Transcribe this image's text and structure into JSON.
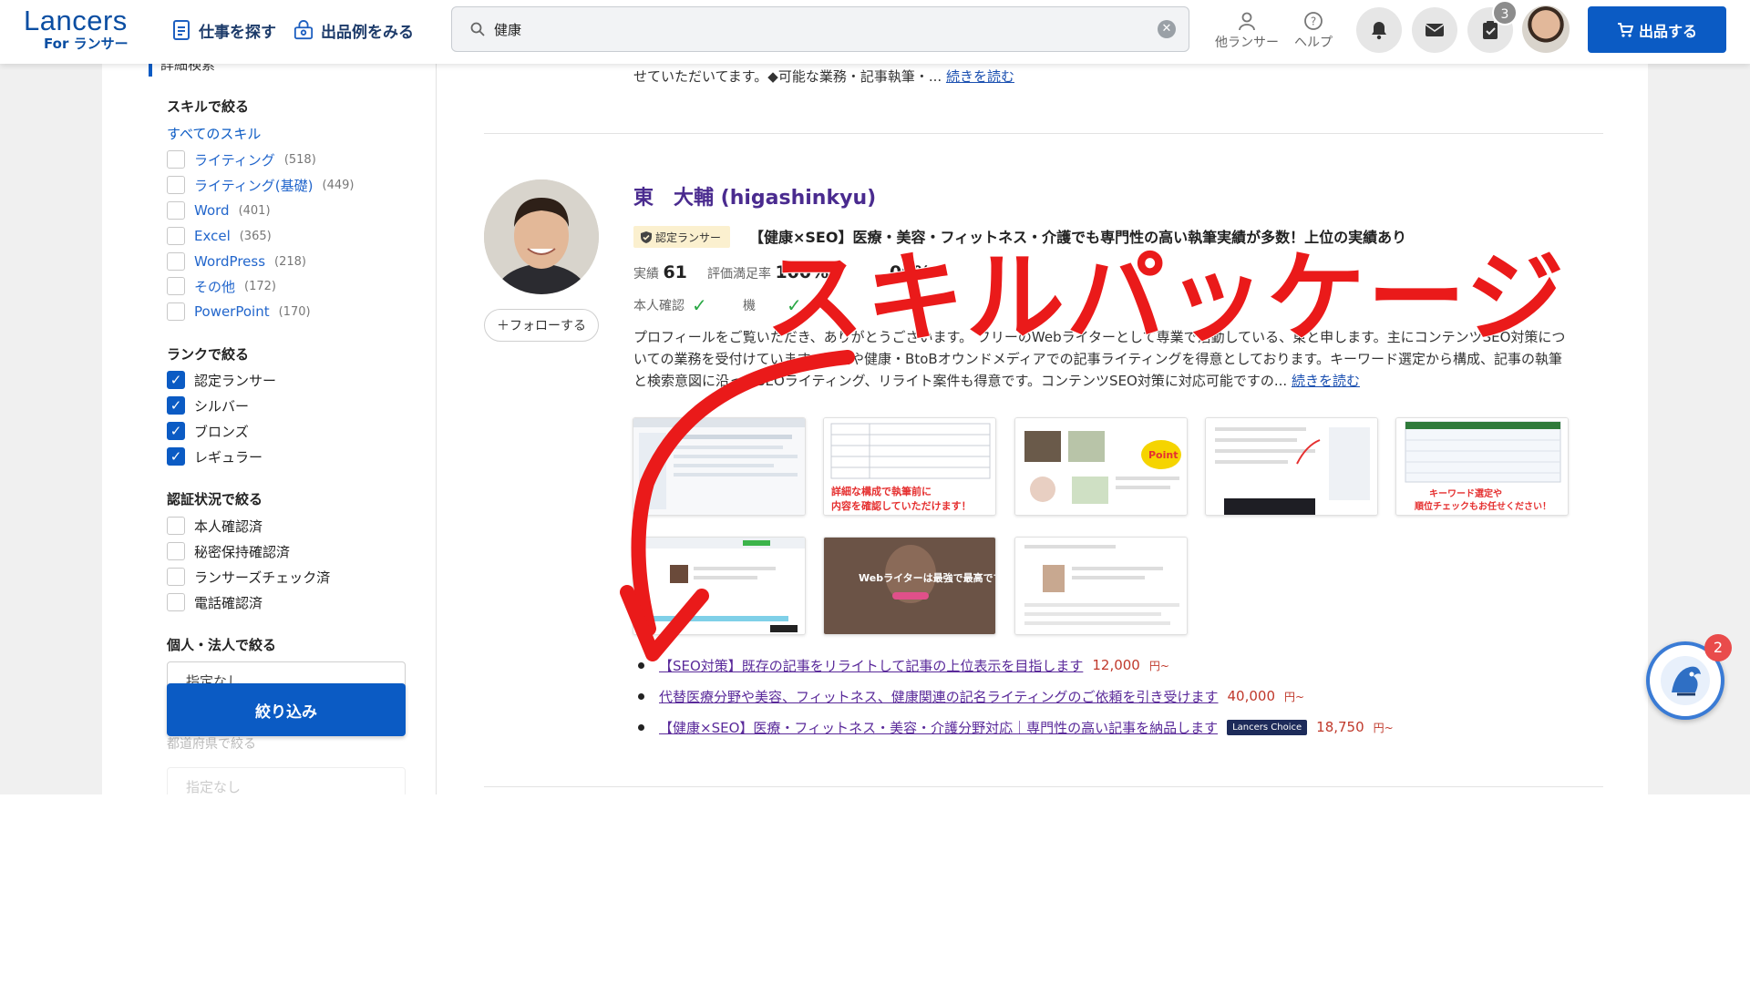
{
  "header": {
    "logo_main": "Lancers",
    "logo_sub": "For ランサー",
    "nav_find_work": "仕事を探す",
    "nav_examples": "出品例をみる",
    "search_value": "健康",
    "other_lancers": "他ランサー",
    "help": "ヘルプ",
    "task_badge_count": "3",
    "publish_label": "出品する"
  },
  "sidebar": {
    "heading": "詳細検索",
    "skill_section": "スキルで絞る",
    "all_skills": "すべてのスキル",
    "skills": [
      {
        "label": "ライティング",
        "count": "(518)"
      },
      {
        "label": "ライティング(基礎)",
        "count": "(449)"
      },
      {
        "label": "Word",
        "count": "(401)"
      },
      {
        "label": "Excel",
        "count": "(365)"
      },
      {
        "label": "WordPress",
        "count": "(218)"
      },
      {
        "label": "その他",
        "count": "(172)"
      },
      {
        "label": "PowerPoint",
        "count": "(170)"
      }
    ],
    "rank_section": "ランクで絞る",
    "ranks": [
      {
        "label": "認定ランサー",
        "checked": true
      },
      {
        "label": "シルバー",
        "checked": true
      },
      {
        "label": "ブロンズ",
        "checked": true
      },
      {
        "label": "レギュラー",
        "checked": true
      }
    ],
    "auth_section": "認証状況で絞る",
    "auths": [
      "本人確認済",
      "秘密保持確認済",
      "ランサーズチェック済",
      "電話確認済"
    ],
    "entity_section": "個人・法人で絞る",
    "entity_select": "指定なし",
    "filter_button": "絞り込み",
    "prefecture_section": "都道府県で絞る",
    "prefecture_select": "指定なし"
  },
  "main": {
    "prev_text": "せていただいてます。◆可能な業務・記事執筆・...",
    "prev_read_more": "続きを読む",
    "profile": {
      "name": "東　大輔 (higashinkyu)",
      "badge": "認定ランサー",
      "catchphrase": "【健康×SEO】医療・美容・フィットネス・介護でも専門性の高い執筆実績が多数！上位の実績あり",
      "results_label": "実績",
      "results_value": "61",
      "rating_label": "評価満足率",
      "rating_value": "100%",
      "extra_value": "00%",
      "identity_label": "本人確認",
      "secret_label": "機",
      "follow_label": "＋フォローする",
      "description": "プロフィールをご覧いただき、ありがとうございます。 フリーのWebライターとして専業で活動している、東と申します。主にコンテンツSEO対策についての業務を受付けています。医療や健康・BtoBオウンドメディアでの記事ライティングを得意としております。キーワード選定から構成、記事の執筆と検索意図に沿ったSEOライティング、リライト案件も得意です。コンテンツSEO対策に対応可能ですの...",
      "read_more": "続きを読む"
    },
    "thumbnails": [
      {
        "caption": ""
      },
      {
        "caption": "詳細な構成で執筆前に\n内容を確認していただけます！"
      },
      {
        "caption": "Point"
      },
      {
        "caption": ""
      },
      {
        "caption": "キーワード選定や\n順位チェックもお任せください！"
      },
      {
        "caption": ""
      },
      {
        "caption": "Webライターは最強で最高です。"
      },
      {
        "caption": ""
      }
    ],
    "packages": [
      {
        "title": "【SEO対策】既存の記事をリライトして記事の上位表示を目指します",
        "price": "12,000",
        "unit": "円~",
        "choice": ""
      },
      {
        "title": "代替医療分野や美容、フィットネス、健康関連の記名ライティングのご依頼を引き受けます",
        "price": "40,000",
        "unit": "円~",
        "choice": ""
      },
      {
        "title": "【健康×SEO】医療・フィットネス・美容・介護分野対応｜専門性の高い記事を納品します",
        "price": "18,750",
        "unit": "円~",
        "choice": "Lancers Choice"
      }
    ]
  },
  "overlay": {
    "annotation_text": "スキルパッケージ",
    "annotation_color": "#ea1a1a"
  },
  "help_widget": {
    "badge_count": "2"
  },
  "colors": {
    "brand_blue": "#0b5bc4",
    "name_purple": "#4a2b8f",
    "price_red": "#c0392b"
  }
}
